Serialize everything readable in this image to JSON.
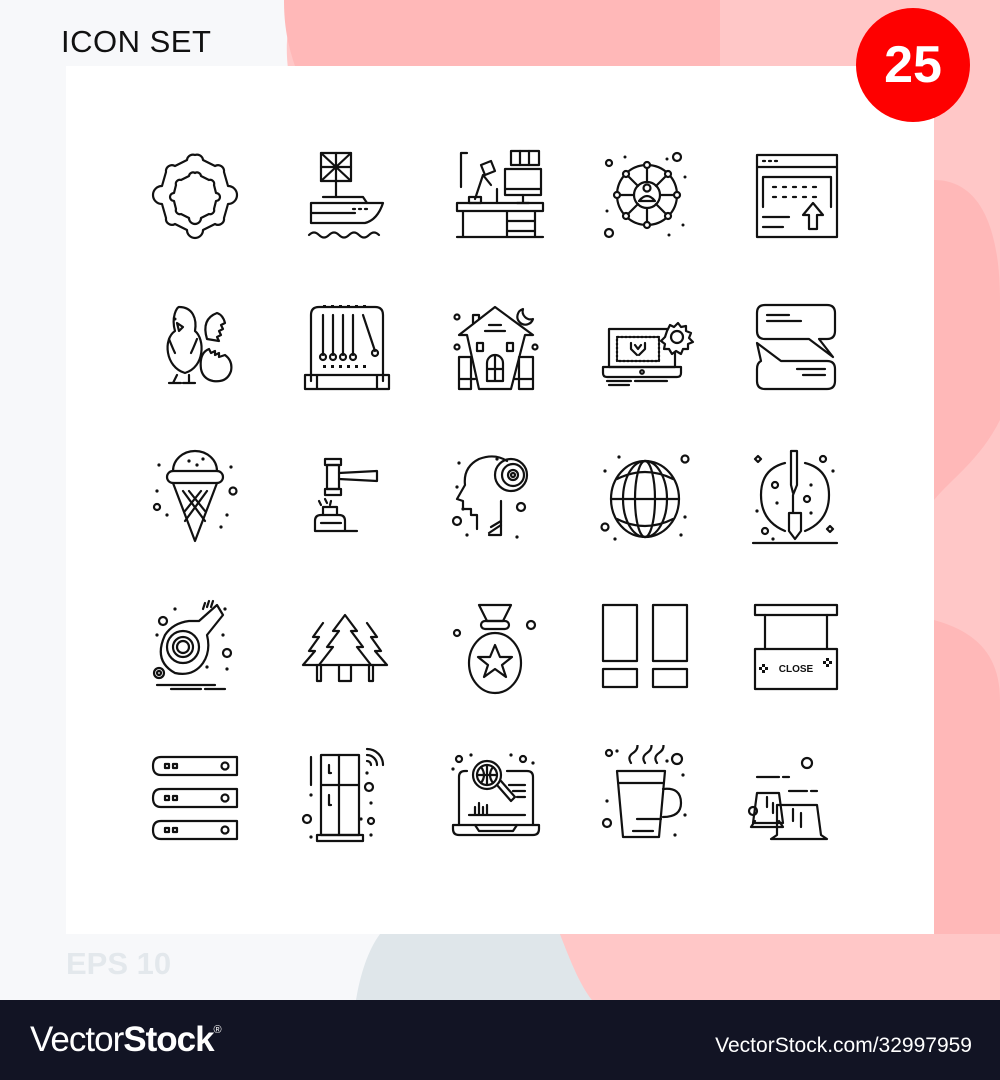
{
  "header": {
    "title": "ICON SET",
    "count_badge": "25"
  },
  "footer_note": "EPS 10",
  "watermark": {
    "brand_light": "Vector",
    "brand_bold": "Stock",
    "registered_mark": "®",
    "reference": "VectorStock.com/32997959"
  },
  "colors": {
    "badge": "#fe0000",
    "blob_pink": "#ffc7c7",
    "blob_pink_dark": "#ffb8b8",
    "blob_gray": "#dfe6ea",
    "footer_bg": "#121424"
  },
  "icons": [
    {
      "row": 1,
      "col": 1,
      "name": "ring-gear-icon"
    },
    {
      "row": 1,
      "col": 2,
      "name": "boat-flag-icon"
    },
    {
      "row": 1,
      "col": 3,
      "name": "desk-workspace-icon"
    },
    {
      "row": 1,
      "col": 4,
      "name": "user-network-icon"
    },
    {
      "row": 1,
      "col": 5,
      "name": "browser-upload-icon"
    },
    {
      "row": 2,
      "col": 1,
      "name": "chick-egg-icon"
    },
    {
      "row": 2,
      "col": 2,
      "name": "newtons-cradle-icon"
    },
    {
      "row": 2,
      "col": 3,
      "name": "haunted-house-icon"
    },
    {
      "row": 2,
      "col": 4,
      "name": "laptop-settings-icon"
    },
    {
      "row": 2,
      "col": 5,
      "name": "chat-bubbles-icon"
    },
    {
      "row": 3,
      "col": 1,
      "name": "ice-cream-cone-icon"
    },
    {
      "row": 3,
      "col": 2,
      "name": "gavel-icon"
    },
    {
      "row": 3,
      "col": 3,
      "name": "head-target-icon"
    },
    {
      "row": 3,
      "col": 4,
      "name": "globe-icon"
    },
    {
      "row": 3,
      "col": 5,
      "name": "shovel-dig-icon"
    },
    {
      "row": 4,
      "col": 1,
      "name": "whistle-icon"
    },
    {
      "row": 4,
      "col": 2,
      "name": "pine-trees-icon"
    },
    {
      "row": 4,
      "col": 3,
      "name": "medal-star-icon"
    },
    {
      "row": 4,
      "col": 4,
      "name": "layout-grid-icon"
    },
    {
      "row": 4,
      "col": 5,
      "name": "close-sign-icon",
      "label": "CLOSE"
    },
    {
      "row": 5,
      "col": 1,
      "name": "server-rack-icon"
    },
    {
      "row": 5,
      "col": 2,
      "name": "smart-fridge-icon"
    },
    {
      "row": 5,
      "col": 3,
      "name": "laptop-search-icon"
    },
    {
      "row": 5,
      "col": 4,
      "name": "hot-cup-icon"
    },
    {
      "row": 5,
      "col": 5,
      "name": "tree-stumps-icon"
    }
  ]
}
